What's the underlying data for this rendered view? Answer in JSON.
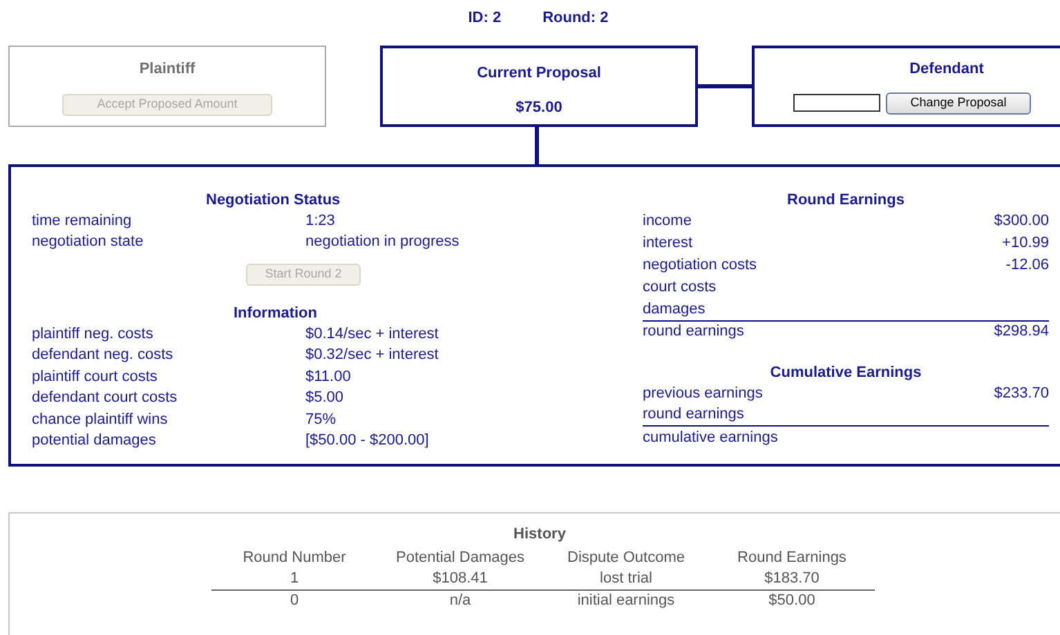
{
  "header": {
    "id_label": "ID: 2",
    "round_label": "Round: 2"
  },
  "plaintiff": {
    "title": "Plaintiff",
    "button": {
      "label": "Accept Proposed Amount",
      "disabled": true
    }
  },
  "proposal": {
    "title": "Current Proposal",
    "amount": "$75.00"
  },
  "defendant": {
    "title": "Defendant",
    "button": {
      "label": "Change Proposal",
      "disabled": false
    }
  },
  "negotiation_status": {
    "title": "Negotiation Status",
    "rows": [
      {
        "label": "time remaining",
        "value": "1:23"
      },
      {
        "label": "negotiation state",
        "value": "negotiation in progress"
      }
    ],
    "button": {
      "label": "Start Round 2",
      "disabled": true
    }
  },
  "information": {
    "title": "Information",
    "rows": [
      {
        "label": "plaintiff neg. costs",
        "value": "$0.14/sec + interest"
      },
      {
        "label": "defendant neg. costs",
        "value": "$0.32/sec + interest"
      },
      {
        "label": "plaintiff court costs",
        "value": "$11.00"
      },
      {
        "label": "defendant court costs",
        "value": "$5.00"
      },
      {
        "label": "chance plaintiff wins",
        "value": "75%"
      },
      {
        "label": "potential damages",
        "value": "[$50.00 - $200.00]"
      }
    ]
  },
  "round_earnings": {
    "title": "Round Earnings",
    "rows": [
      {
        "label": "income",
        "value": "$300.00"
      },
      {
        "label": "interest",
        "value": "+10.99"
      },
      {
        "label": "negotiation costs",
        "value": "-12.06"
      },
      {
        "label": "court costs"
      },
      {
        "label": "damages"
      }
    ],
    "total": {
      "label": "round earnings",
      "value": "$298.94"
    }
  },
  "cumulative_earnings": {
    "title": "Cumulative Earnings",
    "rows": [
      {
        "label": "previous earnings",
        "value": "$233.70"
      },
      {
        "label": "round earnings"
      }
    ],
    "total": {
      "label": "cumulative earnings"
    }
  },
  "history": {
    "title": "History",
    "columns": [
      "Round Number",
      "Potential Damages",
      "Dispute Outcome",
      "Round Earnings"
    ],
    "rows": [
      [
        "1",
        "$108.41",
        "lost trial",
        "$183.70"
      ],
      [
        "0",
        "n/a",
        "initial earnings",
        "$50.00"
      ]
    ]
  }
}
